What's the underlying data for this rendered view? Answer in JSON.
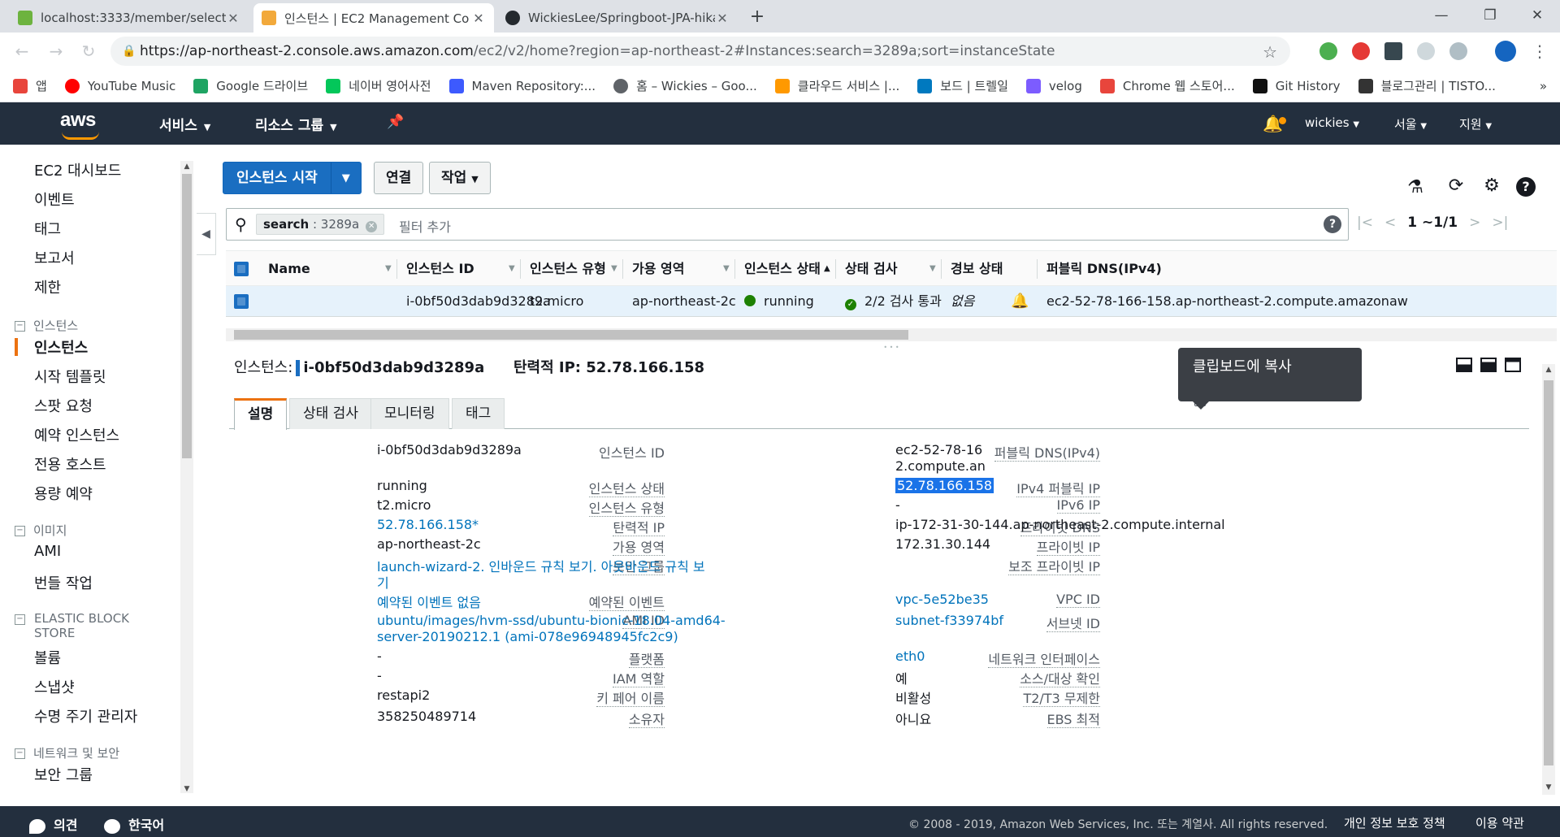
{
  "browser": {
    "tabs": [
      {
        "title": "localhost:3333/member/select/",
        "active": false
      },
      {
        "title": "인스턴스 | EC2 Management Co",
        "active": true
      },
      {
        "title": "WickiesLee/Springboot-JPA-hika",
        "active": false
      }
    ],
    "new_tab": "+",
    "url_host": "https://ap-northeast-2.console.aws.amazon.com",
    "url_path": "/ec2/v2/home?region=ap-northeast-2#Instances:search=3289a;sort=instanceState",
    "bookmarks": [
      {
        "label": "앱",
        "color": "#e8453c"
      },
      {
        "label": "YouTube Music",
        "color": "#ff0000"
      },
      {
        "label": "Google 드라이브",
        "color": "#1fa463"
      },
      {
        "label": "네이버 영어사전",
        "color": "#03c75a"
      },
      {
        "label": "Maven Repository:...",
        "color": "#3d5afe"
      },
      {
        "label": "홈 – Wickies – Goo...",
        "color": "#5f6368"
      },
      {
        "label": "클라우드 서비스 |...",
        "color": "#ff9900"
      },
      {
        "label": "보드 | 트렐일",
        "color": "#0079bf"
      },
      {
        "label": "velog",
        "color": "#7c5cff"
      },
      {
        "label": "Chrome 웹 스토어...",
        "color": "#e8453c"
      },
      {
        "label": "Git History",
        "color": "#111111"
      },
      {
        "label": "블로그관리 | TISTO...",
        "color": "#333333"
      }
    ]
  },
  "aws_header": {
    "logo": "aws",
    "services": "서비스",
    "resource_groups": "리소스 그룹",
    "user": "wickies",
    "region": "서울",
    "support": "지원"
  },
  "sidebar": {
    "top_items": [
      "EC2 대시보드",
      "이벤트",
      "태그",
      "보고서",
      "제한"
    ],
    "sections": [
      {
        "heading": "인스턴스",
        "items": [
          "인스턴스",
          "시작 템플릿",
          "스팟 요청",
          "예약 인스턴스",
          "전용 호스트",
          "용량 예약"
        ]
      },
      {
        "heading": "이미지",
        "items": [
          "AMI",
          "번들 작업"
        ]
      },
      {
        "heading": "ELASTIC BLOCK STORE",
        "items": [
          "볼륨",
          "스냅샷",
          "수명 주기 관리자"
        ]
      },
      {
        "heading": "네트워크 및 보안",
        "items": [
          "보안 그룹"
        ]
      }
    ],
    "active_item": "인스턴스"
  },
  "toolbar": {
    "launch": "인스턴스 시작",
    "connect": "연결",
    "actions": "작업"
  },
  "search": {
    "chip_key": "search",
    "chip_value": ": 3289a",
    "placeholder": "필터 추가",
    "pager": "1 ~1/1"
  },
  "grid": {
    "columns": [
      "Name",
      "인스턴스 ID",
      "인스턴스 유형",
      "가용 영역",
      "인스턴스 상태",
      "상태 검사",
      "경보 상태",
      "퍼블릭 DNS(IPv4)"
    ],
    "row": {
      "name": "",
      "instance_id": "i-0bf50d3dab9d3289a",
      "type": "t2.micro",
      "az": "ap-northeast-2c",
      "state": "running",
      "status_check": "2/2 검사 통과",
      "alarm": "없음",
      "public_dns": "ec2-52-78-166-158.ap-northeast-2.compute.amazonaw"
    }
  },
  "detail": {
    "title_label": "인스턴스:",
    "instance_id": "i-0bf50d3dab9d3289a",
    "elastic_label": "탄력적 IP: 52.78.166.158",
    "tabs": [
      "설명",
      "상태 검사",
      "모니터링",
      "태그"
    ],
    "left": [
      {
        "label": "인스턴스 ID",
        "value": "i-0bf50d3dab9d3289a",
        "link": false
      },
      {
        "label": "인스턴스 상태",
        "value": "running",
        "link": false
      },
      {
        "label": "인스턴스 유형",
        "value": "t2.micro",
        "link": false
      },
      {
        "label": "탄력적 IP",
        "value": "52.78.166.158*",
        "link": true
      },
      {
        "label": "가용 영역",
        "value": "ap-northeast-2c",
        "link": false
      },
      {
        "label": "보안 그룹",
        "value": "launch-wizard-2. 인바운드 규칙 보기. 아웃바운드 규칙 보",
        "value2": "기",
        "link": true
      },
      {
        "label": "예약된 이벤트",
        "value": "예약된 이벤트 없음",
        "link": true
      },
      {
        "label": "AMI ID",
        "value": "ubuntu/images/hvm-ssd/ubuntu-bionic-18.04-amd64-",
        "value2": "server-20190212.1 (ami-078e96948945fc2c9)",
        "link": true
      },
      {
        "label": "플랫폼",
        "value": "-",
        "link": false
      },
      {
        "label": "IAM 역할",
        "value": "-",
        "link": false
      },
      {
        "label": "키 페어 이름",
        "value": "restapi2",
        "link": false
      },
      {
        "label": "소유자",
        "value": "358250489714",
        "link": false
      }
    ],
    "right": [
      {
        "label": "퍼블릭 DNS(IPv4)",
        "value": "ec2-52-78-16",
        "value2": "2.compute.an",
        "link": false
      },
      {
        "label": "IPv4 퍼블릭 IP",
        "value": "52.78.166.158",
        "link": false
      },
      {
        "label": "IPv6 IP",
        "value": "-",
        "link": false
      },
      {
        "label": "프라이빗 DNS",
        "value": "ip-172-31-30-144.ap-northeast-2.compute.internal",
        "link": false
      },
      {
        "label": "프라이빗 IP",
        "value": "172.31.30.144",
        "link": false
      },
      {
        "label": "보조 프라이빗 IP",
        "value": "",
        "link": false
      },
      {
        "label": "VPC ID",
        "value": "vpc-5e52be35",
        "link": true
      },
      {
        "label": "서브넷 ID",
        "value": "subnet-f33974bf",
        "link": true
      },
      {
        "label": "네트워크 인터페이스",
        "value": "eth0",
        "link": true
      },
      {
        "label": "소스/대상 확인",
        "value": "예",
        "link": false
      },
      {
        "label": "T2/T3 무제한",
        "value": "비활성",
        "link": false
      },
      {
        "label": "EBS 최적",
        "value": "아니요",
        "link": false
      }
    ],
    "tooltip": "클립보드에 복사"
  },
  "footer": {
    "feedback": "의견",
    "language": "한국어",
    "copyright": "© 2008 - 2019, Amazon Web Services, Inc. 또는 계열사. All rights reserved.",
    "privacy": "개인 정보 보호 정책",
    "terms": "이용 약관"
  }
}
